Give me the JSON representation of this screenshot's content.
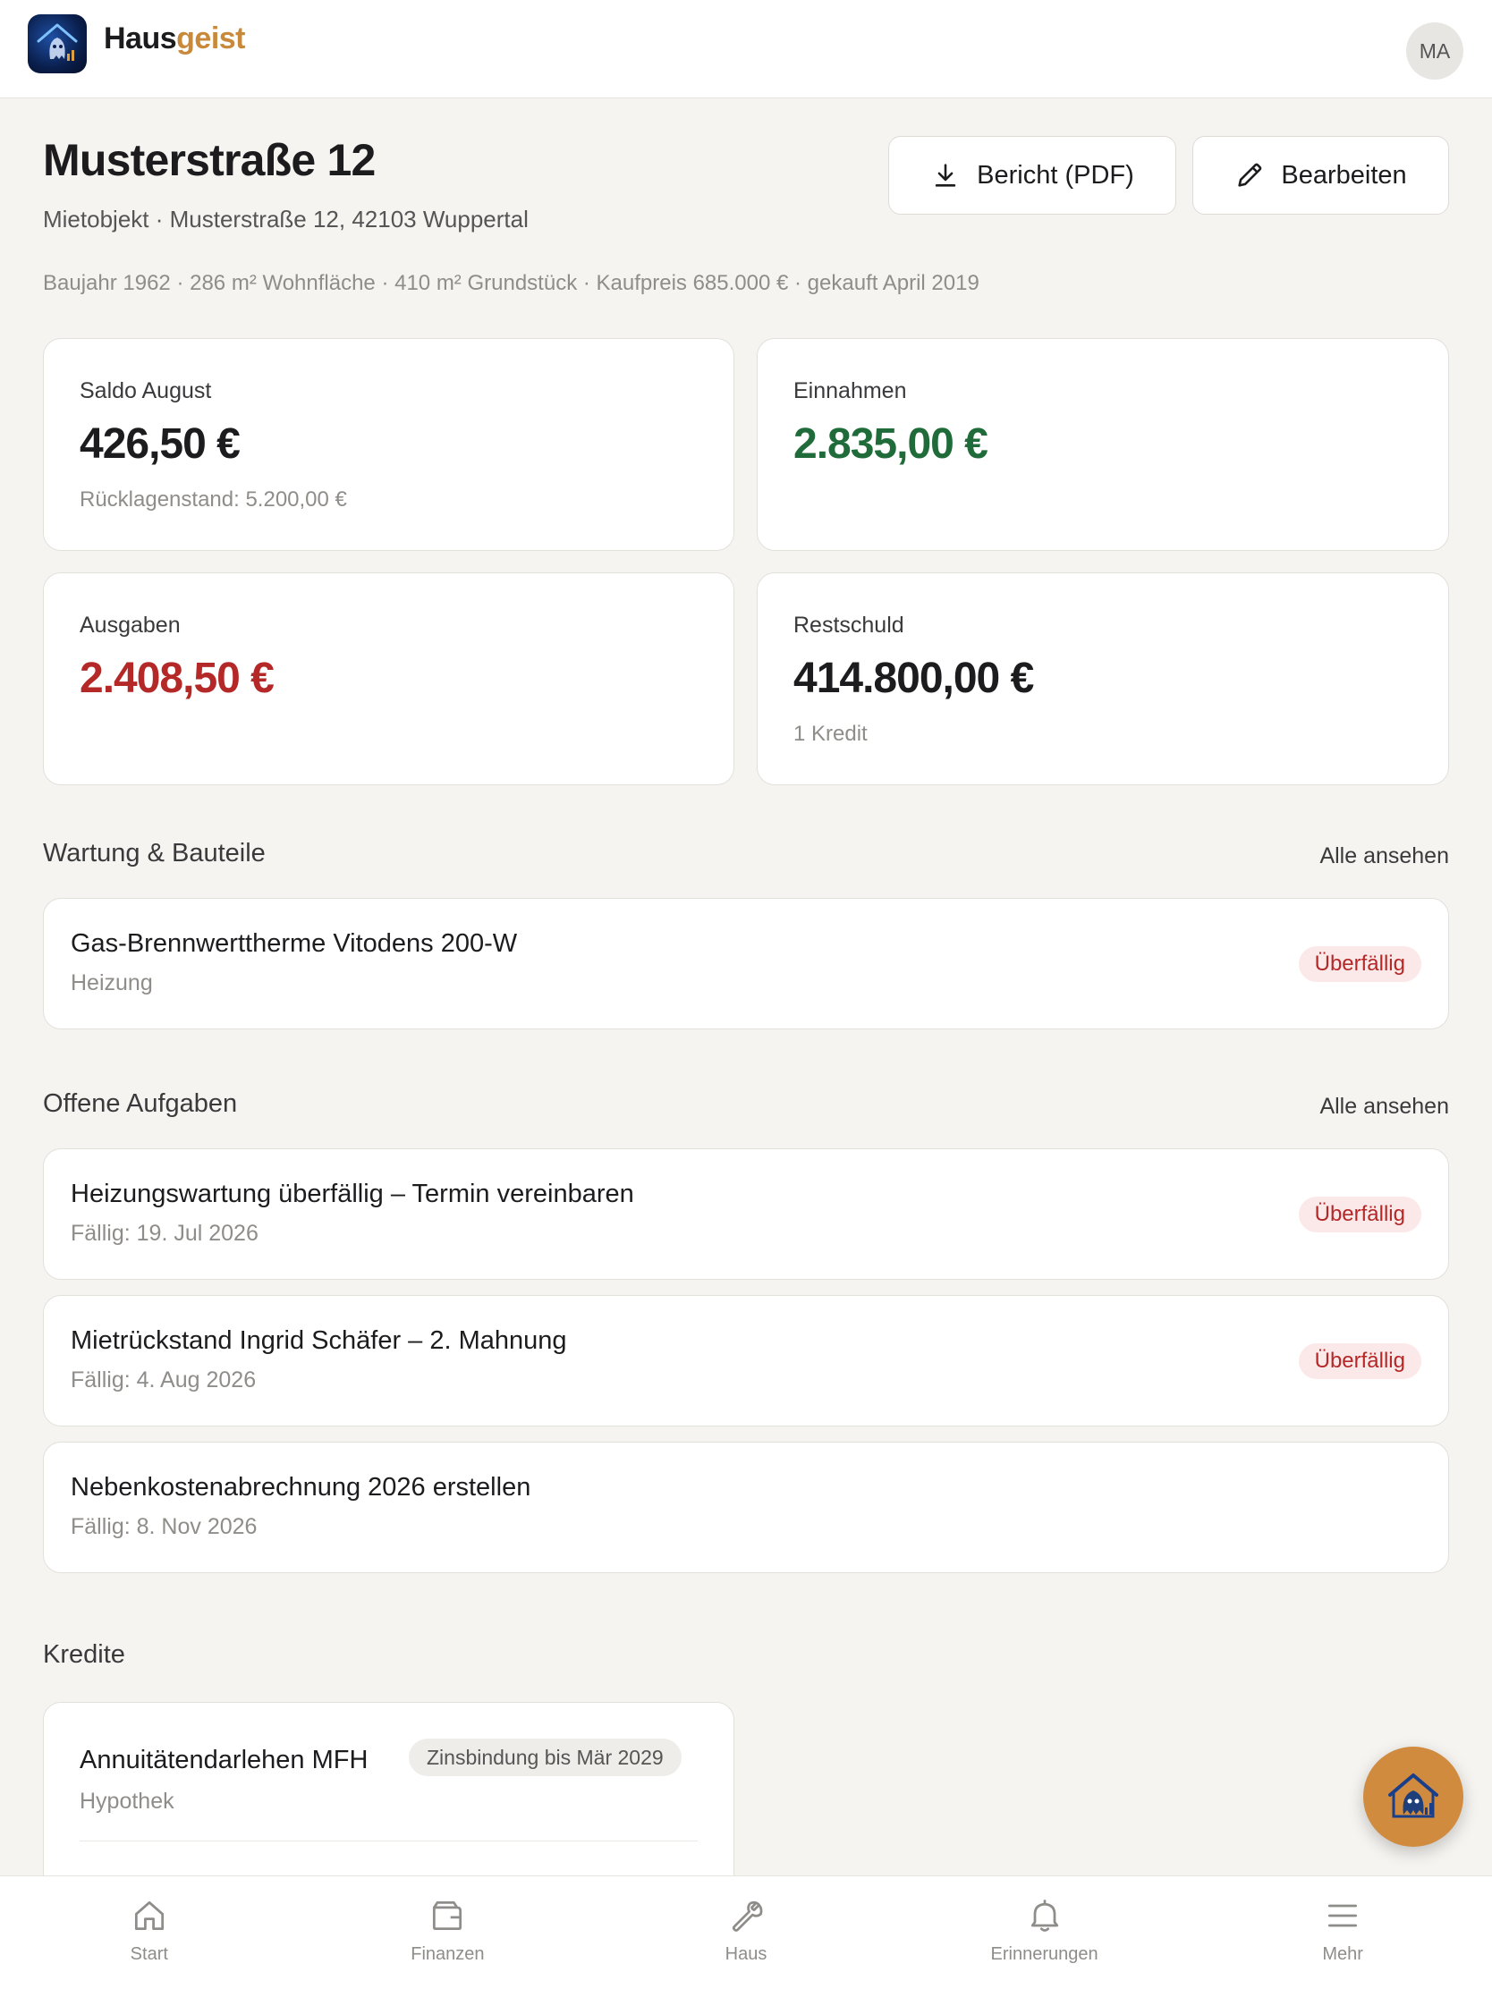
{
  "app": {
    "brand_part1": "Haus",
    "brand_part2": "geist",
    "avatar_initials": "MA"
  },
  "property": {
    "title": "Musterstraße 12",
    "subtitle": "Mietobjekt · Musterstraße 12, 42103 Wuppertal",
    "meta": "Baujahr 1962 · 286 m² Wohnfläche · 410 m² Grundstück · Kaufpreis 685.000 € · gekauft April 2019"
  },
  "actions": {
    "report_label": "Bericht (PDF)",
    "edit_label": "Bearbeiten"
  },
  "stats": [
    {
      "label": "Saldo August",
      "value": "426,50 €",
      "note": "Rücklagenstand: 5.200,00 €",
      "color": "#1c1c1e"
    },
    {
      "label": "Einnahmen",
      "value": "2.835,00 €",
      "note": "",
      "color": "#1f6b3a"
    },
    {
      "label": "Ausgaben",
      "value": "2.408,50 €",
      "note": "",
      "color": "#b42828"
    },
    {
      "label": "Restschuld",
      "value": "414.800,00 €",
      "note": "1 Kredit",
      "color": "#1c1c1e"
    }
  ],
  "maintenance": {
    "title": "Wartung & Bauteile",
    "link": "Alle ansehen",
    "items": [
      {
        "title": "Gas-Brennwerttherme Vitodens 200-W",
        "sub": "Heizung",
        "badge": "Überfällig"
      }
    ]
  },
  "tasks": {
    "title": "Offene Aufgaben",
    "link": "Alle ansehen",
    "items": [
      {
        "title": "Heizungswartung überfällig – Termin vereinbaren",
        "sub": "Fällig: 19. Jul 2026",
        "badge": "Überfällig"
      },
      {
        "title": "Mietrückstand Ingrid Schäfer – 2. Mahnung",
        "sub": "Fällig: 4. Aug 2026",
        "badge": "Überfällig"
      },
      {
        "title": "Nebenkostenabrechnung 2026 erstellen",
        "sub": "Fällig: 8. Nov 2026",
        "badge": ""
      }
    ]
  },
  "credits": {
    "title": "Kredite",
    "items": [
      {
        "title": "Annuitätendarlehen MFH",
        "sub": "Hypothek",
        "badge": "Zinsbindung bis Mär 2029"
      }
    ]
  },
  "tabs": [
    {
      "label": "Start",
      "icon": "home-icon"
    },
    {
      "label": "Finanzen",
      "icon": "wallet-icon"
    },
    {
      "label": "Haus",
      "icon": "wrench-icon"
    },
    {
      "label": "Erinnerungen",
      "icon": "bell-icon"
    },
    {
      "label": "Mehr",
      "icon": "menu-icon"
    }
  ],
  "colors": {
    "accent": "#c88a3a",
    "income": "#1f6b3a",
    "expense": "#b42828",
    "overdue_bg": "#fbe9e9"
  }
}
